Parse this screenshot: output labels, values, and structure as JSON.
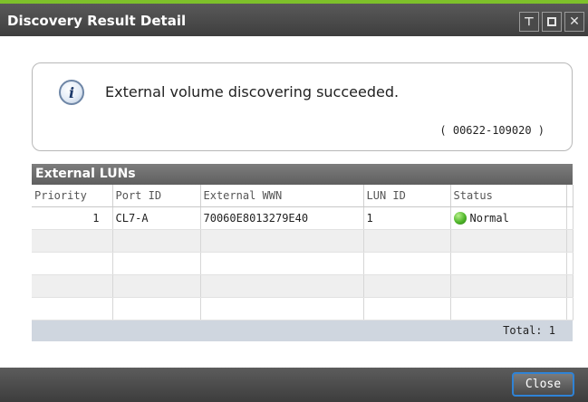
{
  "window": {
    "title": "Discovery Result Detail",
    "buttons": [
      {
        "name": "pin-icon",
        "glyph": "⊤"
      },
      {
        "name": "restore-icon",
        "glyph": ""
      },
      {
        "name": "close-icon",
        "glyph": "✕"
      }
    ]
  },
  "message": {
    "icon": "info-icon",
    "icon_glyph": "i",
    "text": "External volume discovering succeeded.",
    "code": "( 00622-109020 )"
  },
  "external_luns": {
    "title": "External LUNs",
    "columns": [
      "Priority",
      "Port ID",
      "External WWN",
      "LUN ID",
      "Status"
    ],
    "rows": [
      {
        "priority": "1",
        "port_id": "CL7-A",
        "external_wwn": "70060E8013279E40",
        "lun_id": "1",
        "status": "Normal",
        "status_color": "#4fb52a"
      }
    ],
    "empty_rows": 4,
    "total_label": "Total:",
    "total_value": "1"
  },
  "footer": {
    "close_label": "Close"
  },
  "colors": {
    "accent_top": "#7ec12a",
    "focus_border": "#2f83d6"
  }
}
